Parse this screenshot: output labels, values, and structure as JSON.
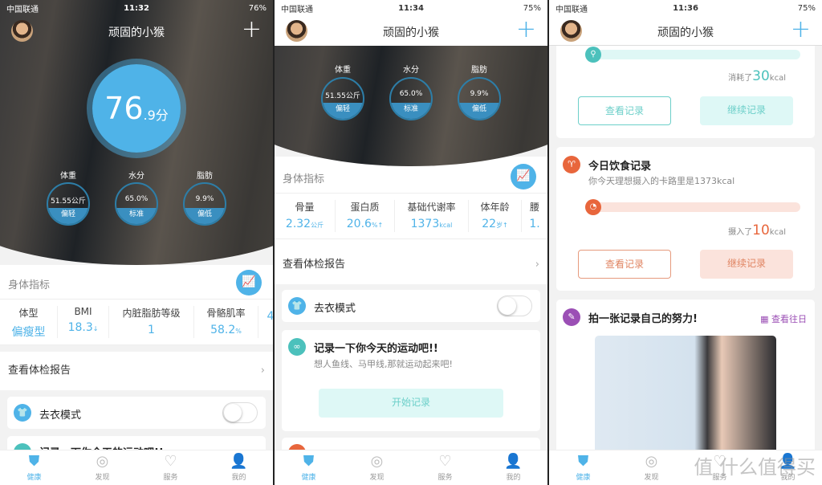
{
  "colors": {
    "accent": "#4fb3e8",
    "teal": "#4cc1bc",
    "orange": "#e8663c",
    "purple": "#9b4fb5"
  },
  "header": {
    "title": "顽固的小猴",
    "add_icon": "plus-icon"
  },
  "screens": [
    {
      "status": {
        "carrier": "中国联通",
        "time": "11:32",
        "battery": "76%"
      },
      "score": {
        "int": "76",
        "dec": ".9分"
      },
      "gauges": [
        {
          "label": "体重",
          "value": "51.55公斤",
          "status": "偏轻"
        },
        {
          "label": "水分",
          "value": "65.0%",
          "status": "标准"
        },
        {
          "label": "脂肪",
          "value": "9.9%",
          "status": "偏低"
        }
      ],
      "section": "身体指标",
      "metrics": [
        {
          "label": "体型",
          "value": "偏瘦型",
          "unit": ""
        },
        {
          "label": "BMI",
          "value": "18.3",
          "unit": "↓"
        },
        {
          "label": "内脏脂肪等级",
          "value": "1",
          "unit": ""
        },
        {
          "label": "骨骼肌率",
          "value": "58.2",
          "unit": "%"
        },
        {
          "label": "",
          "value": "4",
          "unit": ""
        }
      ],
      "report": "查看体检报告",
      "undress": "去衣模式",
      "next_card": "记录一下你今天的运动吧!!"
    },
    {
      "status": {
        "carrier": "中国联通",
        "time": "11:34",
        "battery": "75%"
      },
      "gauges": [
        {
          "label": "体重",
          "value": "51.55公斤",
          "status": "偏轻"
        },
        {
          "label": "水分",
          "value": "65.0%",
          "status": "标准"
        },
        {
          "label": "脂肪",
          "value": "9.9%",
          "status": "偏低"
        }
      ],
      "section": "身体指标",
      "metrics": [
        {
          "label": "骨量",
          "value": "2.32",
          "unit": "公斤"
        },
        {
          "label": "蛋白质",
          "value": "20.6",
          "unit": "%↑"
        },
        {
          "label": "基础代谢率",
          "value": "1373",
          "unit": "kcal"
        },
        {
          "label": "体年龄",
          "value": "22",
          "unit": "岁↑"
        },
        {
          "label": "腰",
          "value": "1.",
          "unit": ""
        }
      ],
      "report": "查看体检报告",
      "undress": "去衣模式",
      "exercise": {
        "title": "记录一下你今天的运动吧!!",
        "subtitle": "想人鱼线、马甲线,那就运动起来吧!",
        "button": "开始记录"
      }
    },
    {
      "status": {
        "carrier": "中国联通",
        "time": "11:36",
        "battery": "75%"
      },
      "exercise": {
        "prefix": "消耗了",
        "value": "30",
        "unit": "kcal",
        "progress": 0.03,
        "view": "查看记录",
        "continue": "继续记录"
      },
      "diet": {
        "title": "今日饮食记录",
        "subtitle": "你今天理想摄入的卡路里是1373kcal",
        "prefix": "摄入了",
        "value": "10",
        "unit": "kcal",
        "progress": 0.01,
        "view": "查看记录",
        "continue": "继续记录"
      },
      "photo": {
        "title": "拍一张记录自己的努力!",
        "history": "查看往日"
      },
      "watermark": "值 什么值得买"
    }
  ],
  "tabs": [
    {
      "label": "健康",
      "icon": "shield-icon",
      "active": true
    },
    {
      "label": "发现",
      "icon": "discover-icon"
    },
    {
      "label": "服务",
      "icon": "heart-icon"
    },
    {
      "label": "我的",
      "icon": "user-icon"
    }
  ]
}
